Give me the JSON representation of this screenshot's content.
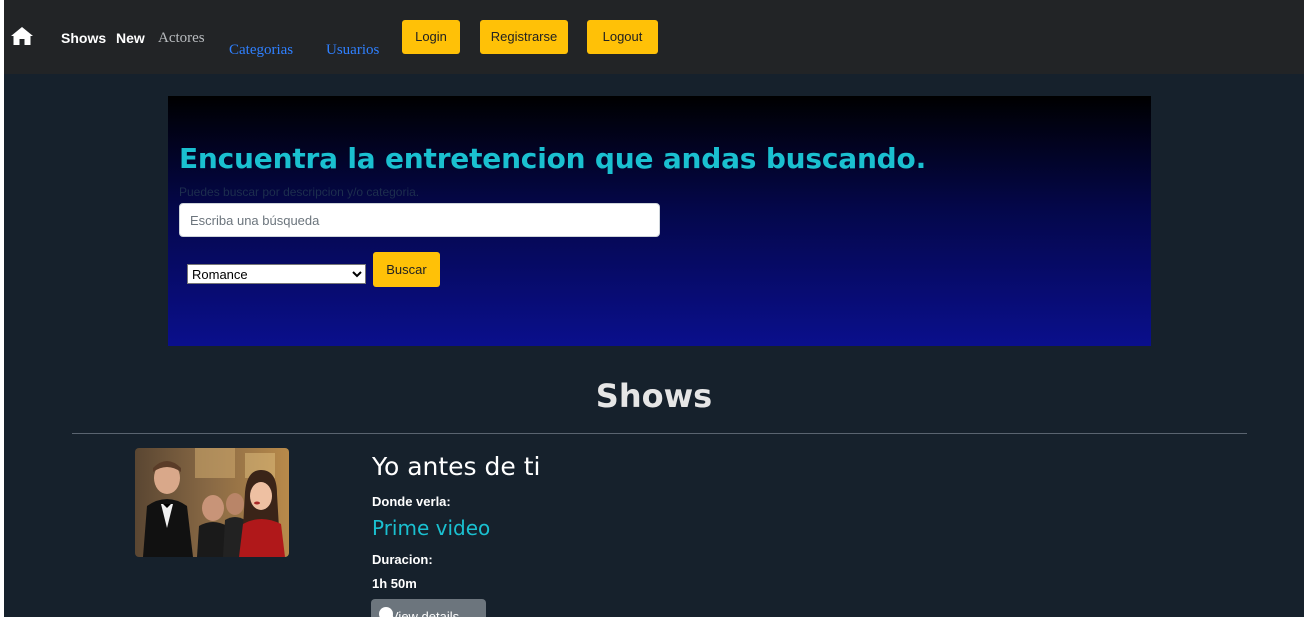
{
  "navbar": {
    "home_icon": "home-icon",
    "links": {
      "shows": "Shows",
      "new": "New",
      "actores": "Actores",
      "categorias": "Categorias",
      "usuarios": "Usuarios"
    },
    "buttons": {
      "login": "Login",
      "registrarse": "Registrarse",
      "logout": "Logout"
    }
  },
  "hero": {
    "title": "Encuentra la entretencion que andas buscando.",
    "subtitle": "Puedes buscar por descripcion y/o categoria.",
    "search_placeholder": "Escriba una búsqueda",
    "search_value": "",
    "category_selected": "Romance",
    "search_button": "Buscar"
  },
  "shows_section": {
    "title": "Shows",
    "items": [
      {
        "title": "Yo antes de ti",
        "where_label": "Donde verla:",
        "platform": "Prime video",
        "duration_label": "Duracion:",
        "duration": "1h 50m",
        "details_button": "View details"
      }
    ]
  },
  "colors": {
    "navbar_bg": "#222426",
    "page_bg": "#16212c",
    "accent_yellow": "#ffc107",
    "accent_cyan": "#1ac0d0",
    "link_blue": "#2f80ff"
  }
}
